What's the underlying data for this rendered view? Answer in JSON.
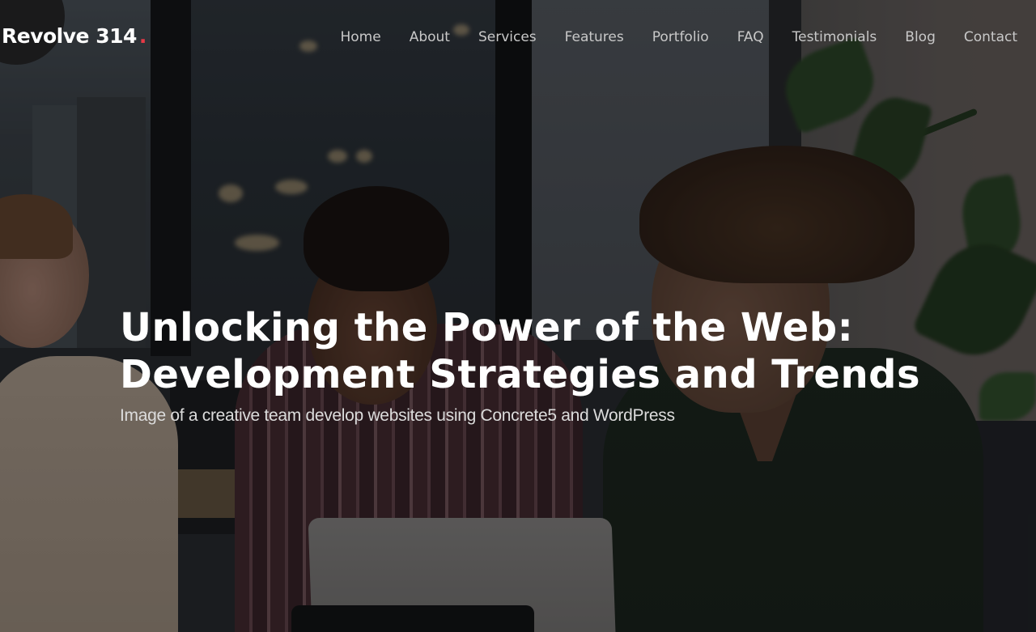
{
  "site": {
    "logo_text": "Revolve 314",
    "logo_dot": ".",
    "accent_color": "#e63946"
  },
  "nav": {
    "items": [
      {
        "label": "Home"
      },
      {
        "label": "About"
      },
      {
        "label": "Services"
      },
      {
        "label": "Features"
      },
      {
        "label": "Portfolio"
      },
      {
        "label": "FAQ"
      },
      {
        "label": "Testimonials"
      },
      {
        "label": "Blog"
      },
      {
        "label": "Contact"
      }
    ]
  },
  "hero": {
    "title_line_1": "Unlocking the Power of the Web:",
    "title_line_2": "Development Strategies and Trends",
    "subtitle": "Image of a creative team develop websites using Concrete5 and WordPress",
    "background_image_alt": "creative team working together around laptops in an office with city windows and a plant"
  }
}
